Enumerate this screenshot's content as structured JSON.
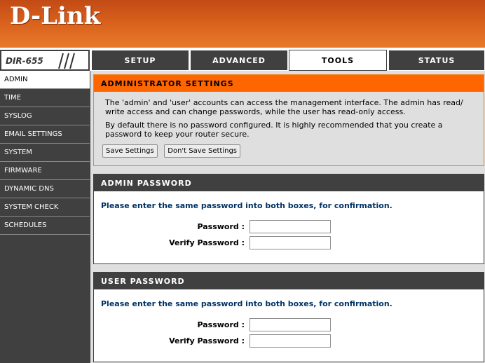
{
  "header": {
    "brand": "D-Link"
  },
  "model": "DIR-655",
  "nav": {
    "tabs": [
      {
        "label": "SETUP"
      },
      {
        "label": "ADVANCED"
      },
      {
        "label": "TOOLS"
      },
      {
        "label": "STATUS"
      }
    ],
    "active": "TOOLS"
  },
  "sidebar": {
    "items": [
      {
        "label": "ADMIN"
      },
      {
        "label": "TIME"
      },
      {
        "label": "SYSLOG"
      },
      {
        "label": "EMAIL SETTINGS"
      },
      {
        "label": "SYSTEM"
      },
      {
        "label": "FIRMWARE"
      },
      {
        "label": "DYNAMIC DNS"
      },
      {
        "label": "SYSTEM CHECK"
      },
      {
        "label": "SCHEDULES"
      }
    ],
    "active": "ADMIN"
  },
  "admin_settings": {
    "title": "ADMINISTRATOR SETTINGS",
    "paragraph1": "The 'admin' and 'user' accounts can access the management interface. The admin has read/ write access and can change passwords, while the user has read-only access.",
    "paragraph2": "By default there is no password configured. It is highly recommended that you create a password to keep your router secure.",
    "save_label": "Save Settings",
    "dont_save_label": "Don't Save Settings"
  },
  "admin_password": {
    "title": "ADMIN PASSWORD",
    "instruction": "Please enter the same password into both boxes, for confirmation.",
    "password_label": "Password :",
    "verify_label": "Verify Password :",
    "password_value": "",
    "verify_value": ""
  },
  "user_password": {
    "title": "USER PASSWORD",
    "instruction": "Please enter the same password into both boxes, for confirmation.",
    "password_label": "Password :",
    "verify_label": "Verify Password :",
    "password_value": "",
    "verify_value": ""
  },
  "colors": {
    "header_orange": "#d8601c",
    "title_orange": "#ff6600",
    "nav_dark": "#404040",
    "panel_gray": "#dfdfdf",
    "instruction_blue": "#003366"
  }
}
